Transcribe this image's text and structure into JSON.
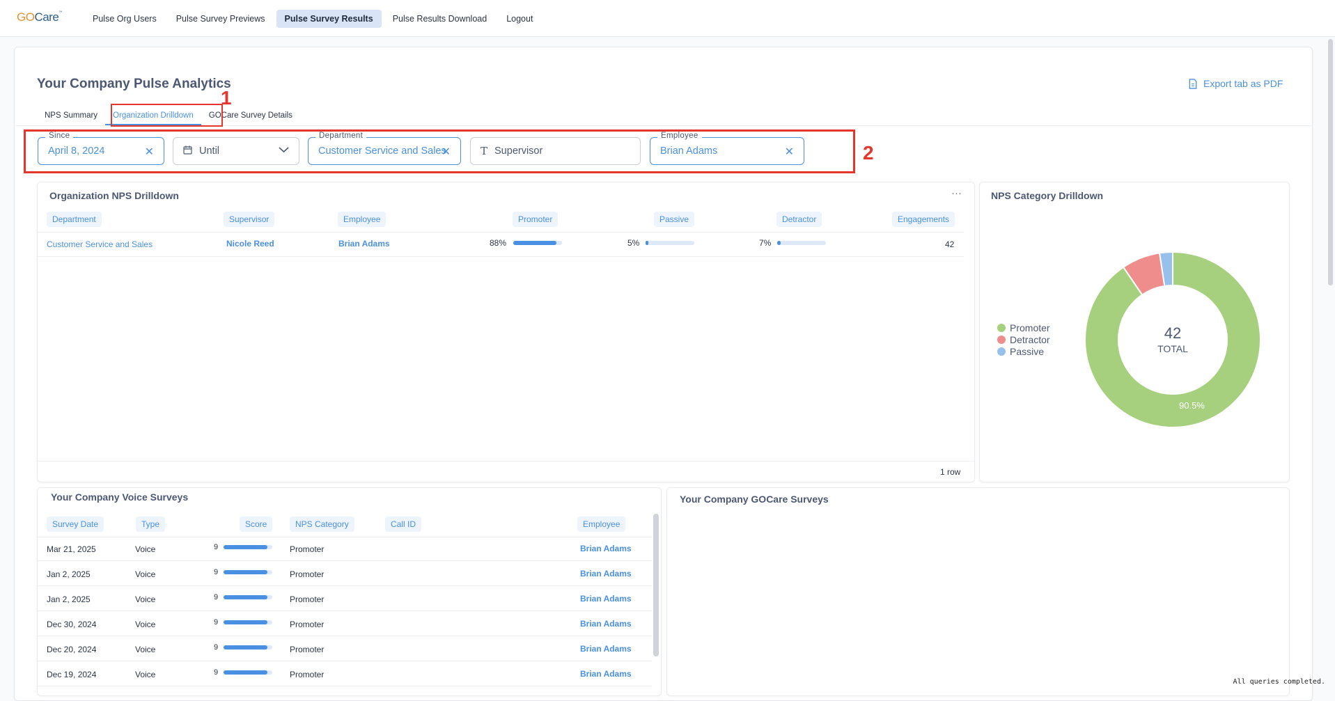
{
  "brand": {
    "go": "GO",
    "care": "Care",
    "tm": "™"
  },
  "nav": [
    "Pulse Org Users",
    "Pulse Survey Previews",
    "Pulse Survey Results",
    "Pulse Results Download",
    "Logout"
  ],
  "nav_active": "Pulse Survey Results",
  "page_title": "Your Company Pulse Analytics",
  "export_label": "Export tab as PDF",
  "tabs": [
    "NPS Summary",
    "Organization Drilldown",
    "GOCare Survey Details"
  ],
  "annotations": {
    "one": "1",
    "two": "2"
  },
  "filters": {
    "since_label": "Since",
    "since_value": "April 8, 2024",
    "until_placeholder": "Until",
    "department_label": "Department",
    "department_value": "Customer Service and Sales",
    "supervisor_placeholder": "Supervisor",
    "employee_label": "Employee",
    "employee_value": "Brian Adams"
  },
  "drilldown": {
    "title": "Organization NPS Drilldown",
    "more": "···",
    "columns": [
      "Department",
      "Supervisor",
      "Employee",
      "Promoter",
      "Passive",
      "Detractor",
      "Engagements"
    ],
    "row": {
      "department": "Customer Service and Sales",
      "supervisor": "Nicole Reed",
      "employee": "Brian Adams",
      "promoter": "88%",
      "promoter_frac": 0.88,
      "passive": "5%",
      "passive_frac": 0.05,
      "detractor": "7%",
      "detractor_frac": 0.07,
      "engagements": "42"
    },
    "row_count": "1 row"
  },
  "category": {
    "title": "NPS Category Drilldown",
    "legend": [
      "Promoter",
      "Detractor",
      "Passive"
    ],
    "total_value": "42",
    "total_label": "TOTAL",
    "promoter_pct_label": "90.5%",
    "colors": {
      "promoter": "#a7d07e",
      "detractor": "#ef8c8c",
      "passive": "#98c0ec"
    }
  },
  "chart_data": {
    "type": "pie",
    "categories": [
      "Promoter",
      "Detractor",
      "Passive"
    ],
    "values": [
      0.905,
      0.071,
      0.024
    ],
    "total": 42
  },
  "voice": {
    "title": "Your Company Voice Surveys",
    "columns": [
      "Survey Date",
      "Type",
      "Score",
      "NPS Category",
      "Call ID",
      "Employee"
    ],
    "rows": [
      {
        "date": "Mar 21, 2025",
        "type": "Voice",
        "score": "9",
        "score_frac": 0.9,
        "category": "Promoter",
        "call_id": "",
        "employee": "Brian Adams"
      },
      {
        "date": "Jan 2, 2025",
        "type": "Voice",
        "score": "9",
        "score_frac": 0.9,
        "category": "Promoter",
        "call_id": "",
        "employee": "Brian Adams"
      },
      {
        "date": "Jan 2, 2025",
        "type": "Voice",
        "score": "9",
        "score_frac": 0.9,
        "category": "Promoter",
        "call_id": "",
        "employee": "Brian Adams"
      },
      {
        "date": "Dec 30, 2024",
        "type": "Voice",
        "score": "9",
        "score_frac": 0.9,
        "category": "Promoter",
        "call_id": "",
        "employee": "Brian Adams"
      },
      {
        "date": "Dec 20, 2024",
        "type": "Voice",
        "score": "9",
        "score_frac": 0.9,
        "category": "Promoter",
        "call_id": "",
        "employee": "Brian Adams"
      },
      {
        "date": "Dec 19, 2024",
        "type": "Voice",
        "score": "9",
        "score_frac": 0.9,
        "category": "Promoter",
        "call_id": "",
        "employee": "Brian Adams"
      }
    ]
  },
  "gocare": {
    "title": "Your Company GOCare Surveys"
  },
  "status": "All queries completed."
}
